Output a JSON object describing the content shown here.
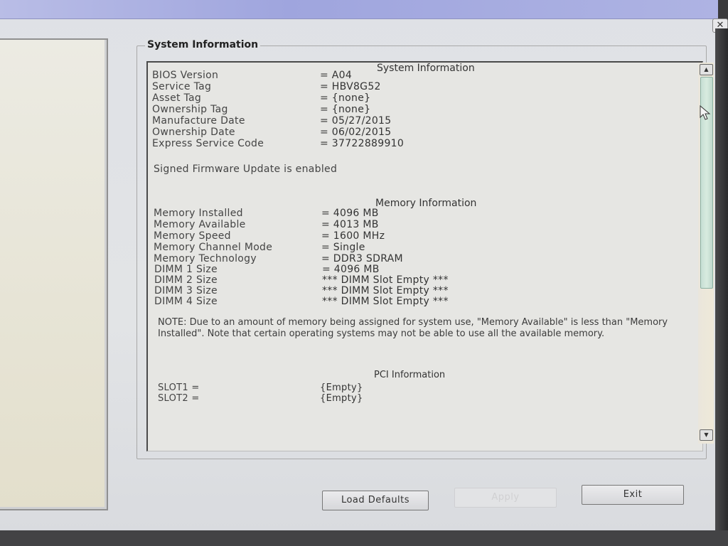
{
  "window": {
    "close_icon": "close-icon",
    "close_glyph": "✕"
  },
  "group": {
    "title": "System Information"
  },
  "system_info": {
    "heading": "System Information",
    "rows": [
      {
        "label": "BIOS Version",
        "value": "= A04"
      },
      {
        "label": "Service Tag",
        "value": "= HBV8G52"
      },
      {
        "label": "Asset Tag",
        "value": "= {none}"
      },
      {
        "label": "Ownership Tag",
        "value": "= {none}"
      },
      {
        "label": "Manufacture Date",
        "value": "= 05/27/2015"
      },
      {
        "label": "Ownership Date",
        "value": "= 06/02/2015"
      },
      {
        "label": "Express Service Code",
        "value": "= 37722889910"
      }
    ],
    "firmware_status": "Signed Firmware Update is enabled"
  },
  "memory_info": {
    "heading": "Memory Information",
    "rows": [
      {
        "label": "Memory Installed",
        "value": "= 4096 MB"
      },
      {
        "label": "Memory Available",
        "value": "= 4013 MB"
      },
      {
        "label": "Memory Speed",
        "value": "= 1600 MHz"
      },
      {
        "label": "Memory Channel Mode",
        "value": "= Single"
      },
      {
        "label": "Memory Technology",
        "value": "= DDR3 SDRAM"
      },
      {
        "label": "DIMM 1 Size",
        "value": "= 4096 MB"
      },
      {
        "label": "DIMM 2 Size",
        "value": "*** DIMM Slot Empty ***"
      },
      {
        "label": "DIMM 3 Size",
        "value": "*** DIMM Slot Empty ***"
      },
      {
        "label": "DIMM 4 Size",
        "value": "*** DIMM Slot Empty ***"
      }
    ],
    "note": "NOTE: Due to an amount of memory being assigned for system use, \"Memory Available\" is less than \"Memory Installed\". Note that certain operating systems may not be able to use all the available memory."
  },
  "pci_info": {
    "heading": "PCI Information",
    "rows": [
      {
        "label": "SLOT1 =",
        "value": "{Empty}"
      },
      {
        "label": "SLOT2 =",
        "value": "{Empty}"
      }
    ]
  },
  "scrollbar": {
    "up_glyph": "▲",
    "down_glyph": "▼",
    "position_fraction": 0.0,
    "visible_fraction": 0.6
  },
  "buttons": {
    "load_defaults": "Load Defaults",
    "apply": "Apply",
    "exit": "Exit"
  }
}
